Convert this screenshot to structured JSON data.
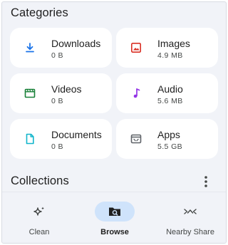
{
  "categories": {
    "title": "Categories",
    "items": [
      {
        "label": "Downloads",
        "size": "0 B",
        "icon": "download-icon",
        "color": "#1a73e8"
      },
      {
        "label": "Images",
        "size": "4.9 MB",
        "icon": "image-icon",
        "color": "#d93025"
      },
      {
        "label": "Videos",
        "size": "0 B",
        "icon": "video-icon",
        "color": "#188038"
      },
      {
        "label": "Audio",
        "size": "5.6 MB",
        "icon": "music-note-icon",
        "color": "#9334e6"
      },
      {
        "label": "Documents",
        "size": "0 B",
        "icon": "document-icon",
        "color": "#12b5cb"
      },
      {
        "label": "Apps",
        "size": "5.5 GB",
        "icon": "apps-icon",
        "color": "#5f6368"
      }
    ]
  },
  "collections": {
    "title": "Collections",
    "menu_icon": "more-vert-icon"
  },
  "bottom_nav": {
    "items": [
      {
        "label": "Clean",
        "icon": "sparkle-icon",
        "active": false
      },
      {
        "label": "Browse",
        "icon": "browse-folder-icon",
        "active": true
      },
      {
        "label": "Nearby Share",
        "icon": "nearby-share-icon",
        "active": false
      }
    ]
  },
  "colors": {
    "background": "#f1f3f8",
    "card": "#ffffff",
    "active_pill": "#cfe3fb"
  }
}
